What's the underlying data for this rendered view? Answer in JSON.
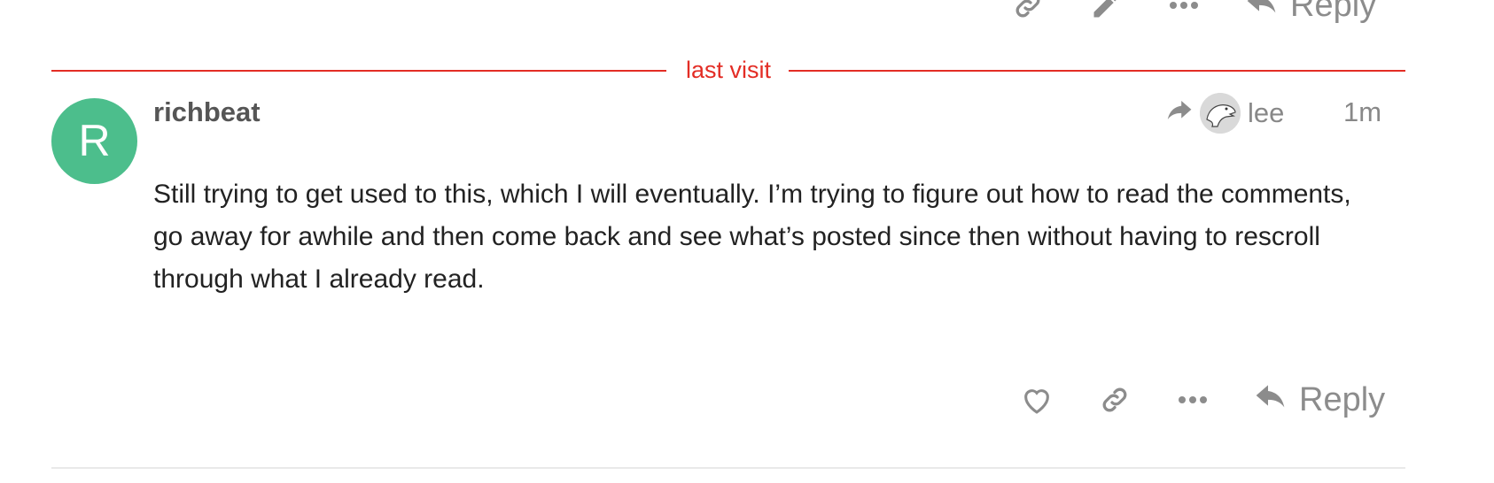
{
  "previous_post": {
    "actions": {
      "copy_link_icon": "link-icon",
      "edit_icon": "pencil-icon",
      "more_icon": "ellipsis-icon",
      "reply_label": "Reply"
    }
  },
  "divider": {
    "label": "last visit",
    "color": "#e32d25"
  },
  "post": {
    "avatar_letter": "R",
    "avatar_color": "#4cbe8c",
    "username": "richbeat",
    "reply_to_user": "lee",
    "time_ago": "1m",
    "body": "Still trying to get used to this, which I will eventually. I’m trying to figure out how to read the comments, go away for awhile and then come back and see what’s posted since then without having to rescroll through what I already read.",
    "actions": {
      "like_icon": "heart-icon",
      "copy_link_icon": "link-icon",
      "more_icon": "ellipsis-icon",
      "reply_label": "Reply"
    }
  }
}
